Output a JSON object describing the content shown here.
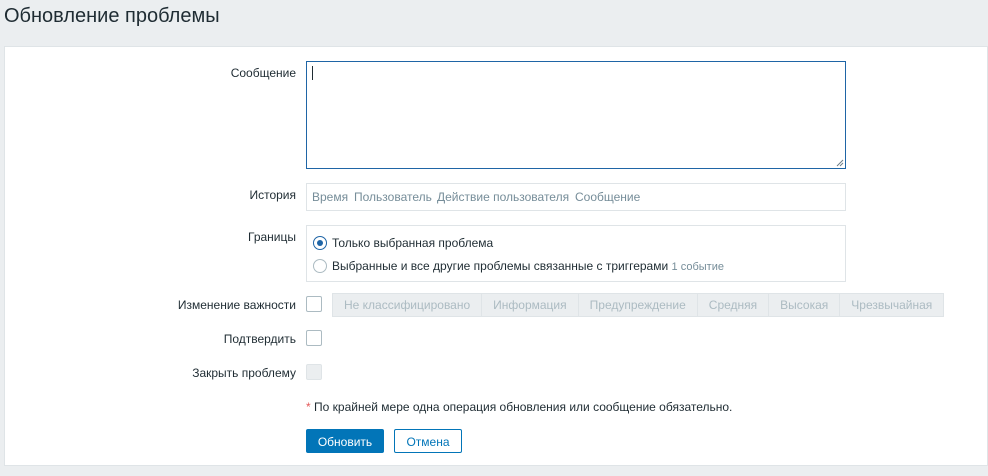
{
  "page": {
    "title": "Обновление проблемы"
  },
  "form": {
    "message": {
      "label": "Сообщение",
      "value": ""
    },
    "history": {
      "label": "История",
      "columns": [
        "Время",
        "Пользователь",
        "Действие пользователя",
        "Сообщение"
      ]
    },
    "scope": {
      "label": "Границы",
      "options": [
        {
          "label": "Только выбранная проблема",
          "selected": true
        },
        {
          "label": "Выбранные и все другие проблемы связанные с триггерами",
          "selected": false,
          "link": "1 событие"
        }
      ]
    },
    "severity": {
      "label": "Изменение важности",
      "checked": false,
      "levels": [
        "Не классифицировано",
        "Информация",
        "Предупреждение",
        "Средняя",
        "Высокая",
        "Чрезвычайная"
      ]
    },
    "acknowledge": {
      "label": "Подтвердить",
      "checked": false
    },
    "close_problem": {
      "label": "Закрыть проблему",
      "checked": false,
      "disabled": true
    },
    "note": {
      "star": "*",
      "text": "По крайней мере одна операция обновления или сообщение обязательно."
    },
    "buttons": {
      "update": "Обновить",
      "cancel": "Отмена"
    }
  },
  "colors": {
    "accent": "#0275b8",
    "required": "#e45959",
    "muted": "#768d99"
  }
}
